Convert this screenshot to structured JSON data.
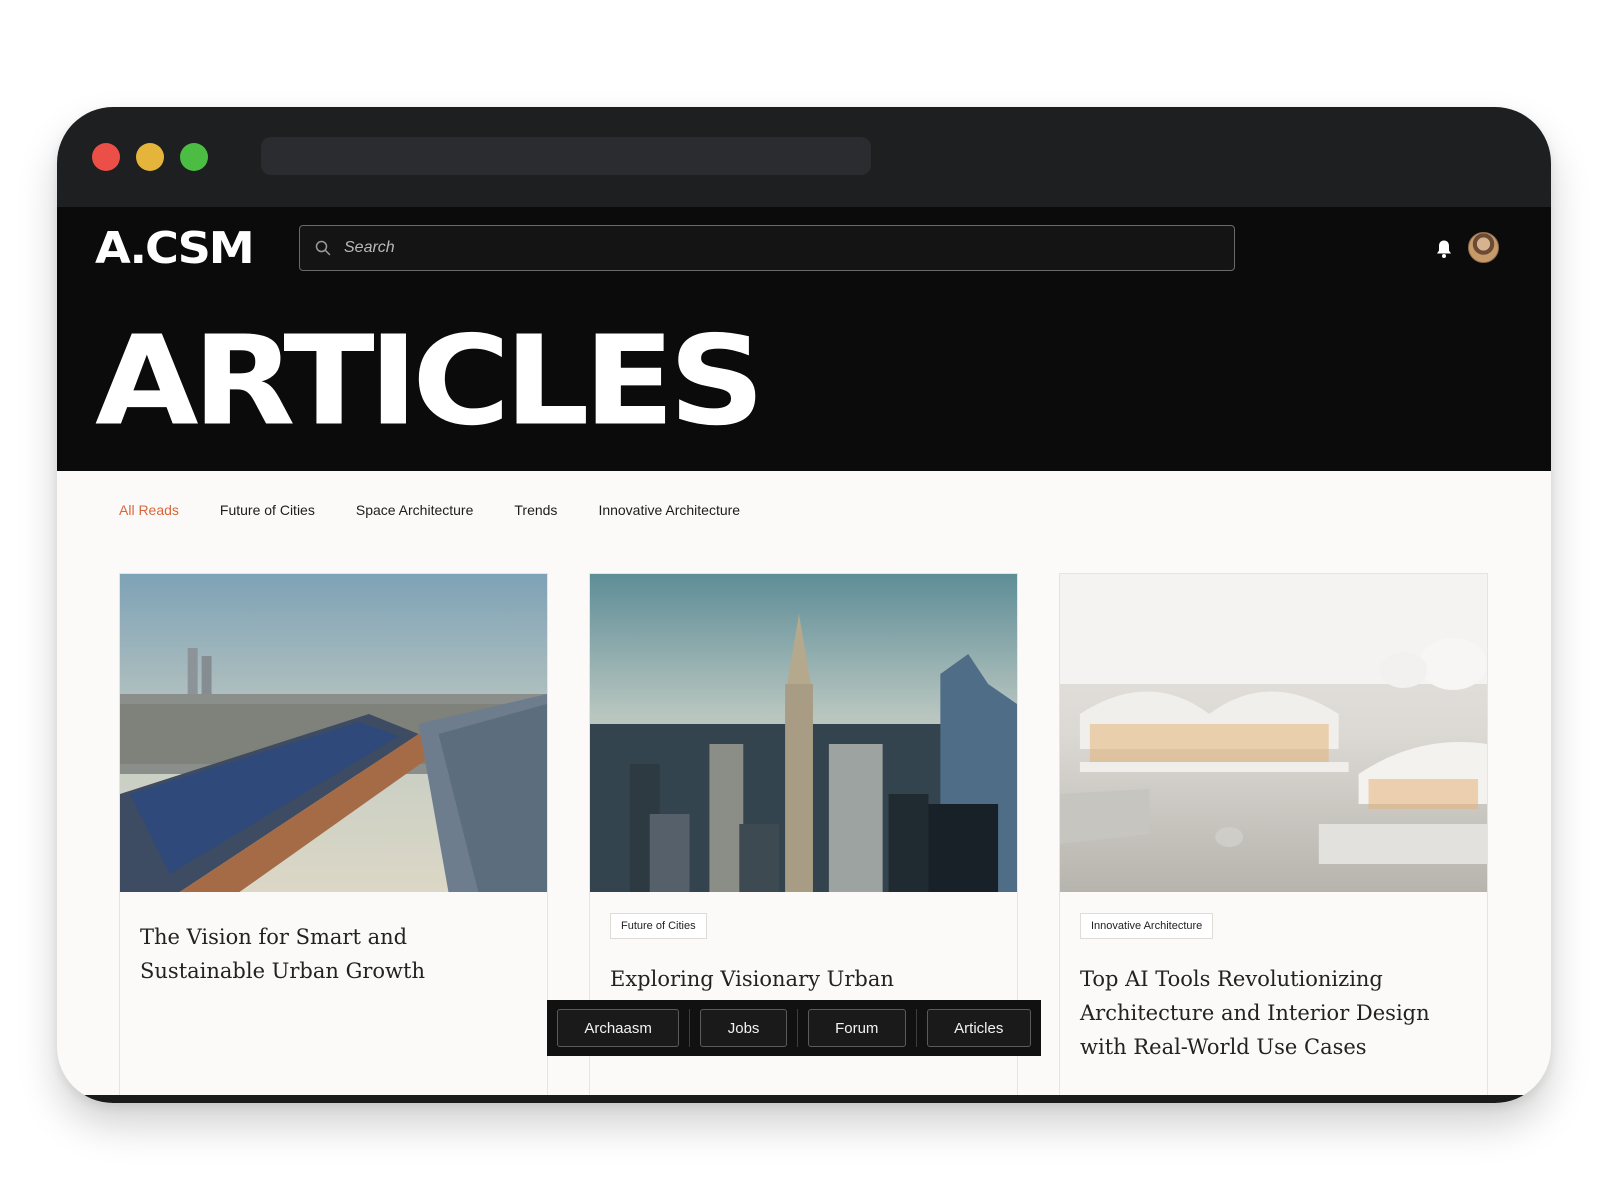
{
  "header": {
    "logo": "A.CSM",
    "search_placeholder": "Search",
    "page_title": "ARTICLES"
  },
  "tabs": [
    {
      "label": "All Reads",
      "active": true
    },
    {
      "label": "Future of Cities"
    },
    {
      "label": "Space Architecture"
    },
    {
      "label": "Trends"
    },
    {
      "label": "Innovative Architecture"
    }
  ],
  "cards": [
    {
      "title": "The Vision for Smart and Sustainable Urban Growth",
      "tag": "",
      "image": "rooftop solar panels over city"
    },
    {
      "title": "Exploring Visionary Urban Development",
      "tag": "Future of Cities",
      "image": "city skyline with skyscrapers"
    },
    {
      "title": "Top AI Tools Revolutionizing Architecture and Interior Design with Real-World Use Cases",
      "tag": "Innovative Architecture",
      "image": "white architectural model with curved roofs"
    }
  ],
  "bottom_nav": [
    "Archaasm",
    "Jobs",
    "Forum",
    "Articles"
  ],
  "colors": {
    "accent": "#d8663a",
    "header_bg": "#0b0b0b",
    "titlebar_bg": "#1e1f21"
  }
}
